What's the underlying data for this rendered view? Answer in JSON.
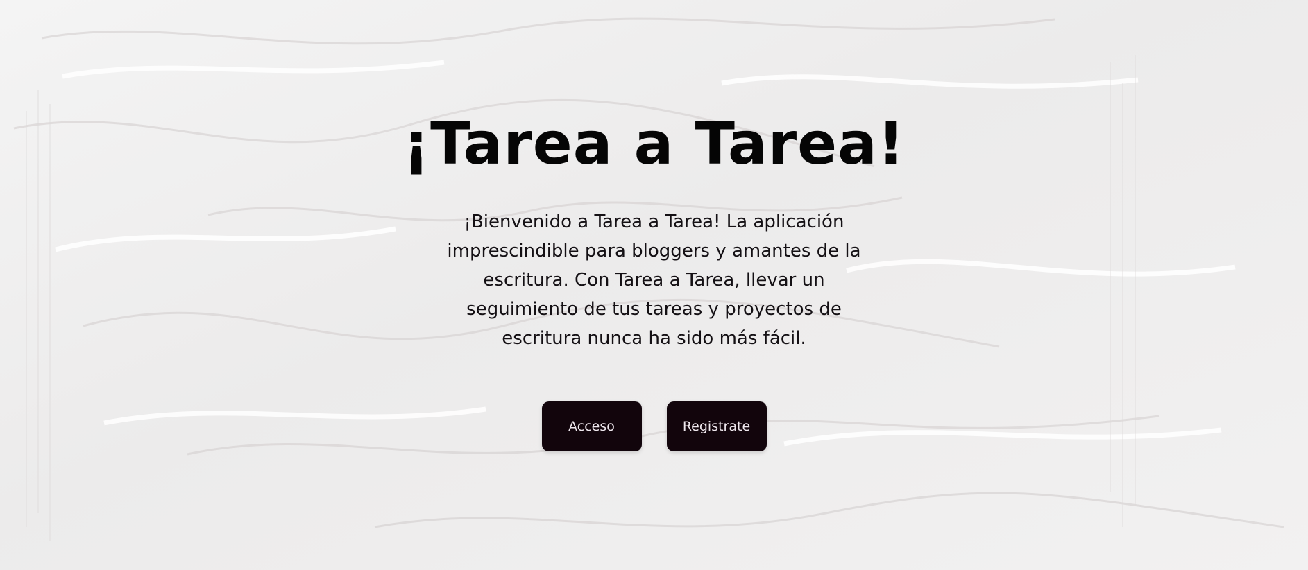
{
  "hero": {
    "title": "¡Tarea a Tarea!",
    "description": "¡Bienvenido a Tarea a Tarea! La aplicación imprescindible para bloggers y amantes de la escritura. Con Tarea a Tarea, llevar un seguimiento de tus tareas y proyectos de escritura nunca ha sido más fácil.",
    "buttons": {
      "login": "Acceso",
      "register": "Registrate"
    }
  },
  "colors": {
    "background": "#efeeee",
    "button": "#12050c",
    "button_text": "#efe8ee",
    "title": "#050505"
  }
}
